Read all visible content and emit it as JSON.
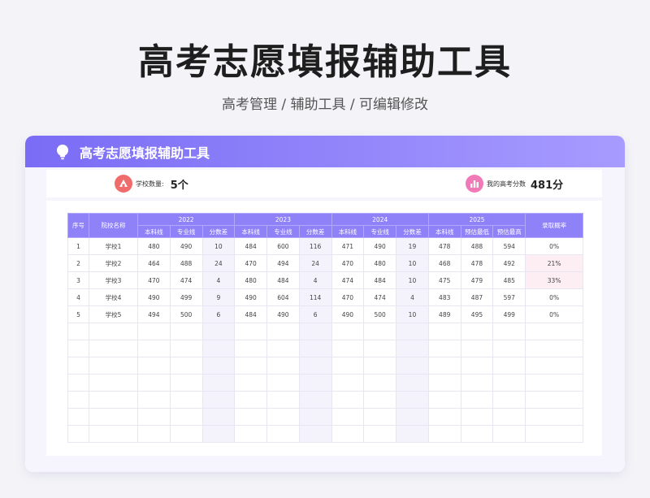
{
  "page": {
    "title": "高考志愿填报辅助工具",
    "subtitle": "高考管理 / 辅助工具 /  可编辑修改"
  },
  "card": {
    "title": "高考志愿填报辅助工具",
    "icon": "lightbulb-icon"
  },
  "stats": {
    "school_count_label": "学校数量:",
    "school_count_value": "5个",
    "school_icon": "school-icon",
    "score_label": "我的高考分数",
    "score_value": "481分",
    "score_icon": "bar-chart-icon"
  },
  "colors": {
    "accent": "#7a6cf5",
    "header": "#8f81f8",
    "school_icon_bg": "#f06b6b",
    "score_icon_bg": "#f07ab8",
    "highlight_cell": "#fdeef3"
  },
  "table": {
    "col_index": "序号",
    "col_name": "院校名称",
    "col_probability": "录取概率",
    "years": [
      "2022",
      "2023",
      "2024",
      "2025"
    ],
    "sub_headers": {
      "past": [
        "本科线",
        "专业线",
        "分数差"
      ],
      "forecast": [
        "本科线",
        "预估最低",
        "预估最高"
      ]
    },
    "rows": [
      [
        "1",
        "学校1",
        "480",
        "490",
        "10",
        "484",
        "600",
        "116",
        "471",
        "490",
        "19",
        "478",
        "488",
        "594",
        "0%"
      ],
      [
        "2",
        "学校2",
        "464",
        "488",
        "24",
        "470",
        "494",
        "24",
        "470",
        "480",
        "10",
        "468",
        "478",
        "492",
        "21%"
      ],
      [
        "3",
        "学校3",
        "470",
        "474",
        "4",
        "480",
        "484",
        "4",
        "474",
        "484",
        "10",
        "475",
        "479",
        "485",
        "33%"
      ],
      [
        "4",
        "学校4",
        "490",
        "499",
        "9",
        "490",
        "604",
        "114",
        "470",
        "474",
        "4",
        "483",
        "487",
        "597",
        "0%"
      ],
      [
        "5",
        "学校5",
        "494",
        "500",
        "6",
        "484",
        "490",
        "6",
        "490",
        "500",
        "10",
        "489",
        "495",
        "499",
        "0%"
      ]
    ],
    "highlight_rows": [
      1,
      2
    ]
  }
}
